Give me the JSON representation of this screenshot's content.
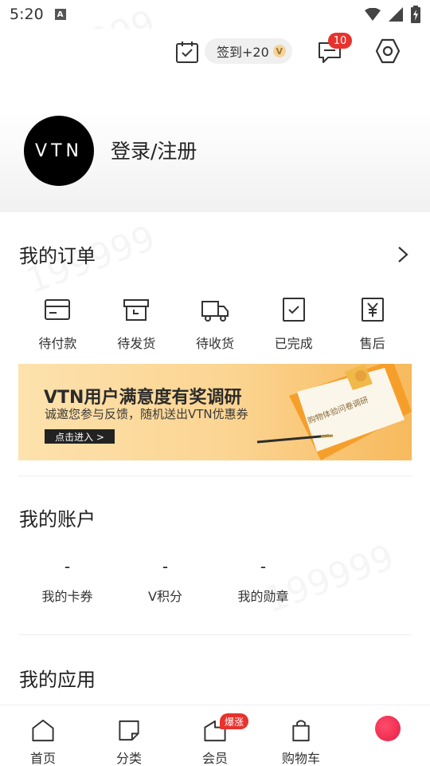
{
  "status_bar": {
    "time": "5:20",
    "indicator": "A"
  },
  "header": {
    "sign_in_label": "签到+20",
    "coin_label": "V",
    "message_count": "10"
  },
  "profile": {
    "avatar_text": "VTN",
    "login_label": "登录/注册"
  },
  "orders": {
    "title": "我的订单",
    "items": [
      {
        "label": "待付款",
        "icon": "wallet-icon"
      },
      {
        "label": "待发货",
        "icon": "box-icon"
      },
      {
        "label": "待收货",
        "icon": "truck-icon"
      },
      {
        "label": "已完成",
        "icon": "check-icon"
      },
      {
        "label": "售后",
        "icon": "yen-icon"
      }
    ]
  },
  "banner": {
    "title": "VTN用户满意度有奖调研",
    "subtitle": "诚邀您参与反馈，随机送出VTN优惠券",
    "button": "点击进入 >",
    "card_text": "购物体验问卷调研"
  },
  "account": {
    "title": "我的账户",
    "items": [
      {
        "value": "-",
        "label": "我的卡券"
      },
      {
        "value": "-",
        "label": "V积分"
      },
      {
        "value": "-",
        "label": "我的勋章"
      }
    ]
  },
  "apps": {
    "title": "我的应用"
  },
  "bottom_nav": {
    "items": [
      {
        "label": "首页",
        "icon": "home-icon"
      },
      {
        "label": "分类",
        "icon": "category-icon"
      },
      {
        "label": "会员",
        "icon": "member-icon"
      },
      {
        "label": "购物车",
        "icon": "bag-icon"
      }
    ],
    "hot_badge": "爆涨"
  },
  "watermark_text": "199999",
  "colors": {
    "accent_red": "#e8322d",
    "banner_orange": "#f7b95c"
  }
}
